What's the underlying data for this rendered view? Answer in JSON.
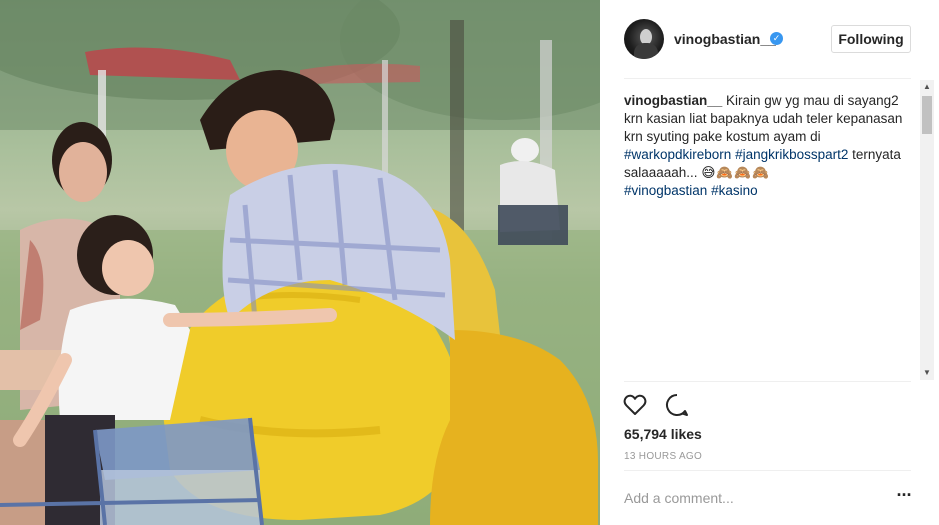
{
  "post": {
    "photo_alt": "",
    "author": {
      "username": "vinogbastian__",
      "verified": true,
      "avatar_icon": "profile-avatar"
    },
    "follow_button": "Following",
    "caption": {
      "user": "vinogbastian__",
      "text_1": " Kirain gw yg mau di sayang2 krn kasian liat bapaknya udah teler kepanasan krn syuting pake kostum ayam di ",
      "tag_1": "#warkopdkireborn",
      "tag_2": "#jangkrikbosspart2",
      "text_2": " ternyata salaaaaah... ",
      "emoji": "😅🙈🙈🙈",
      "tag_3": "#vinogbastian",
      "tag_4": "#kasino"
    },
    "likes": "65,794 likes",
    "time_ago": "13 HOURS AGO",
    "comment_placeholder": "Add a comment...",
    "more_label": "···"
  },
  "icons": {
    "like": "heart-icon",
    "comment": "comment-bubble-icon",
    "verified": "verified-badge-icon",
    "more": "more-options-icon"
  },
  "colors": {
    "hashtag": "#003569",
    "verified": "#3897f0",
    "muted": "#999999",
    "text": "#262626",
    "divider": "#efefef"
  }
}
